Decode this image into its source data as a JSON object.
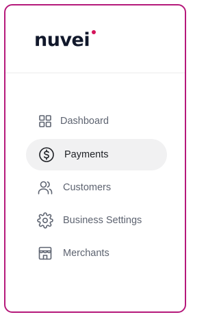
{
  "brand": {
    "logo_text": "nuvei",
    "logo_dot_color": "#d4145a",
    "frame_color": "#b5187a"
  },
  "sidebar": {
    "items": [
      {
        "label": "Dashboard",
        "icon": "grid-icon",
        "active": false
      },
      {
        "label": "Payments",
        "icon": "dollar-circle-icon",
        "active": true
      },
      {
        "label": "Customers",
        "icon": "users-icon",
        "active": false
      },
      {
        "label": "Business Settings",
        "icon": "gear-icon",
        "active": false
      },
      {
        "label": "Merchants",
        "icon": "store-icon",
        "active": false
      }
    ]
  }
}
